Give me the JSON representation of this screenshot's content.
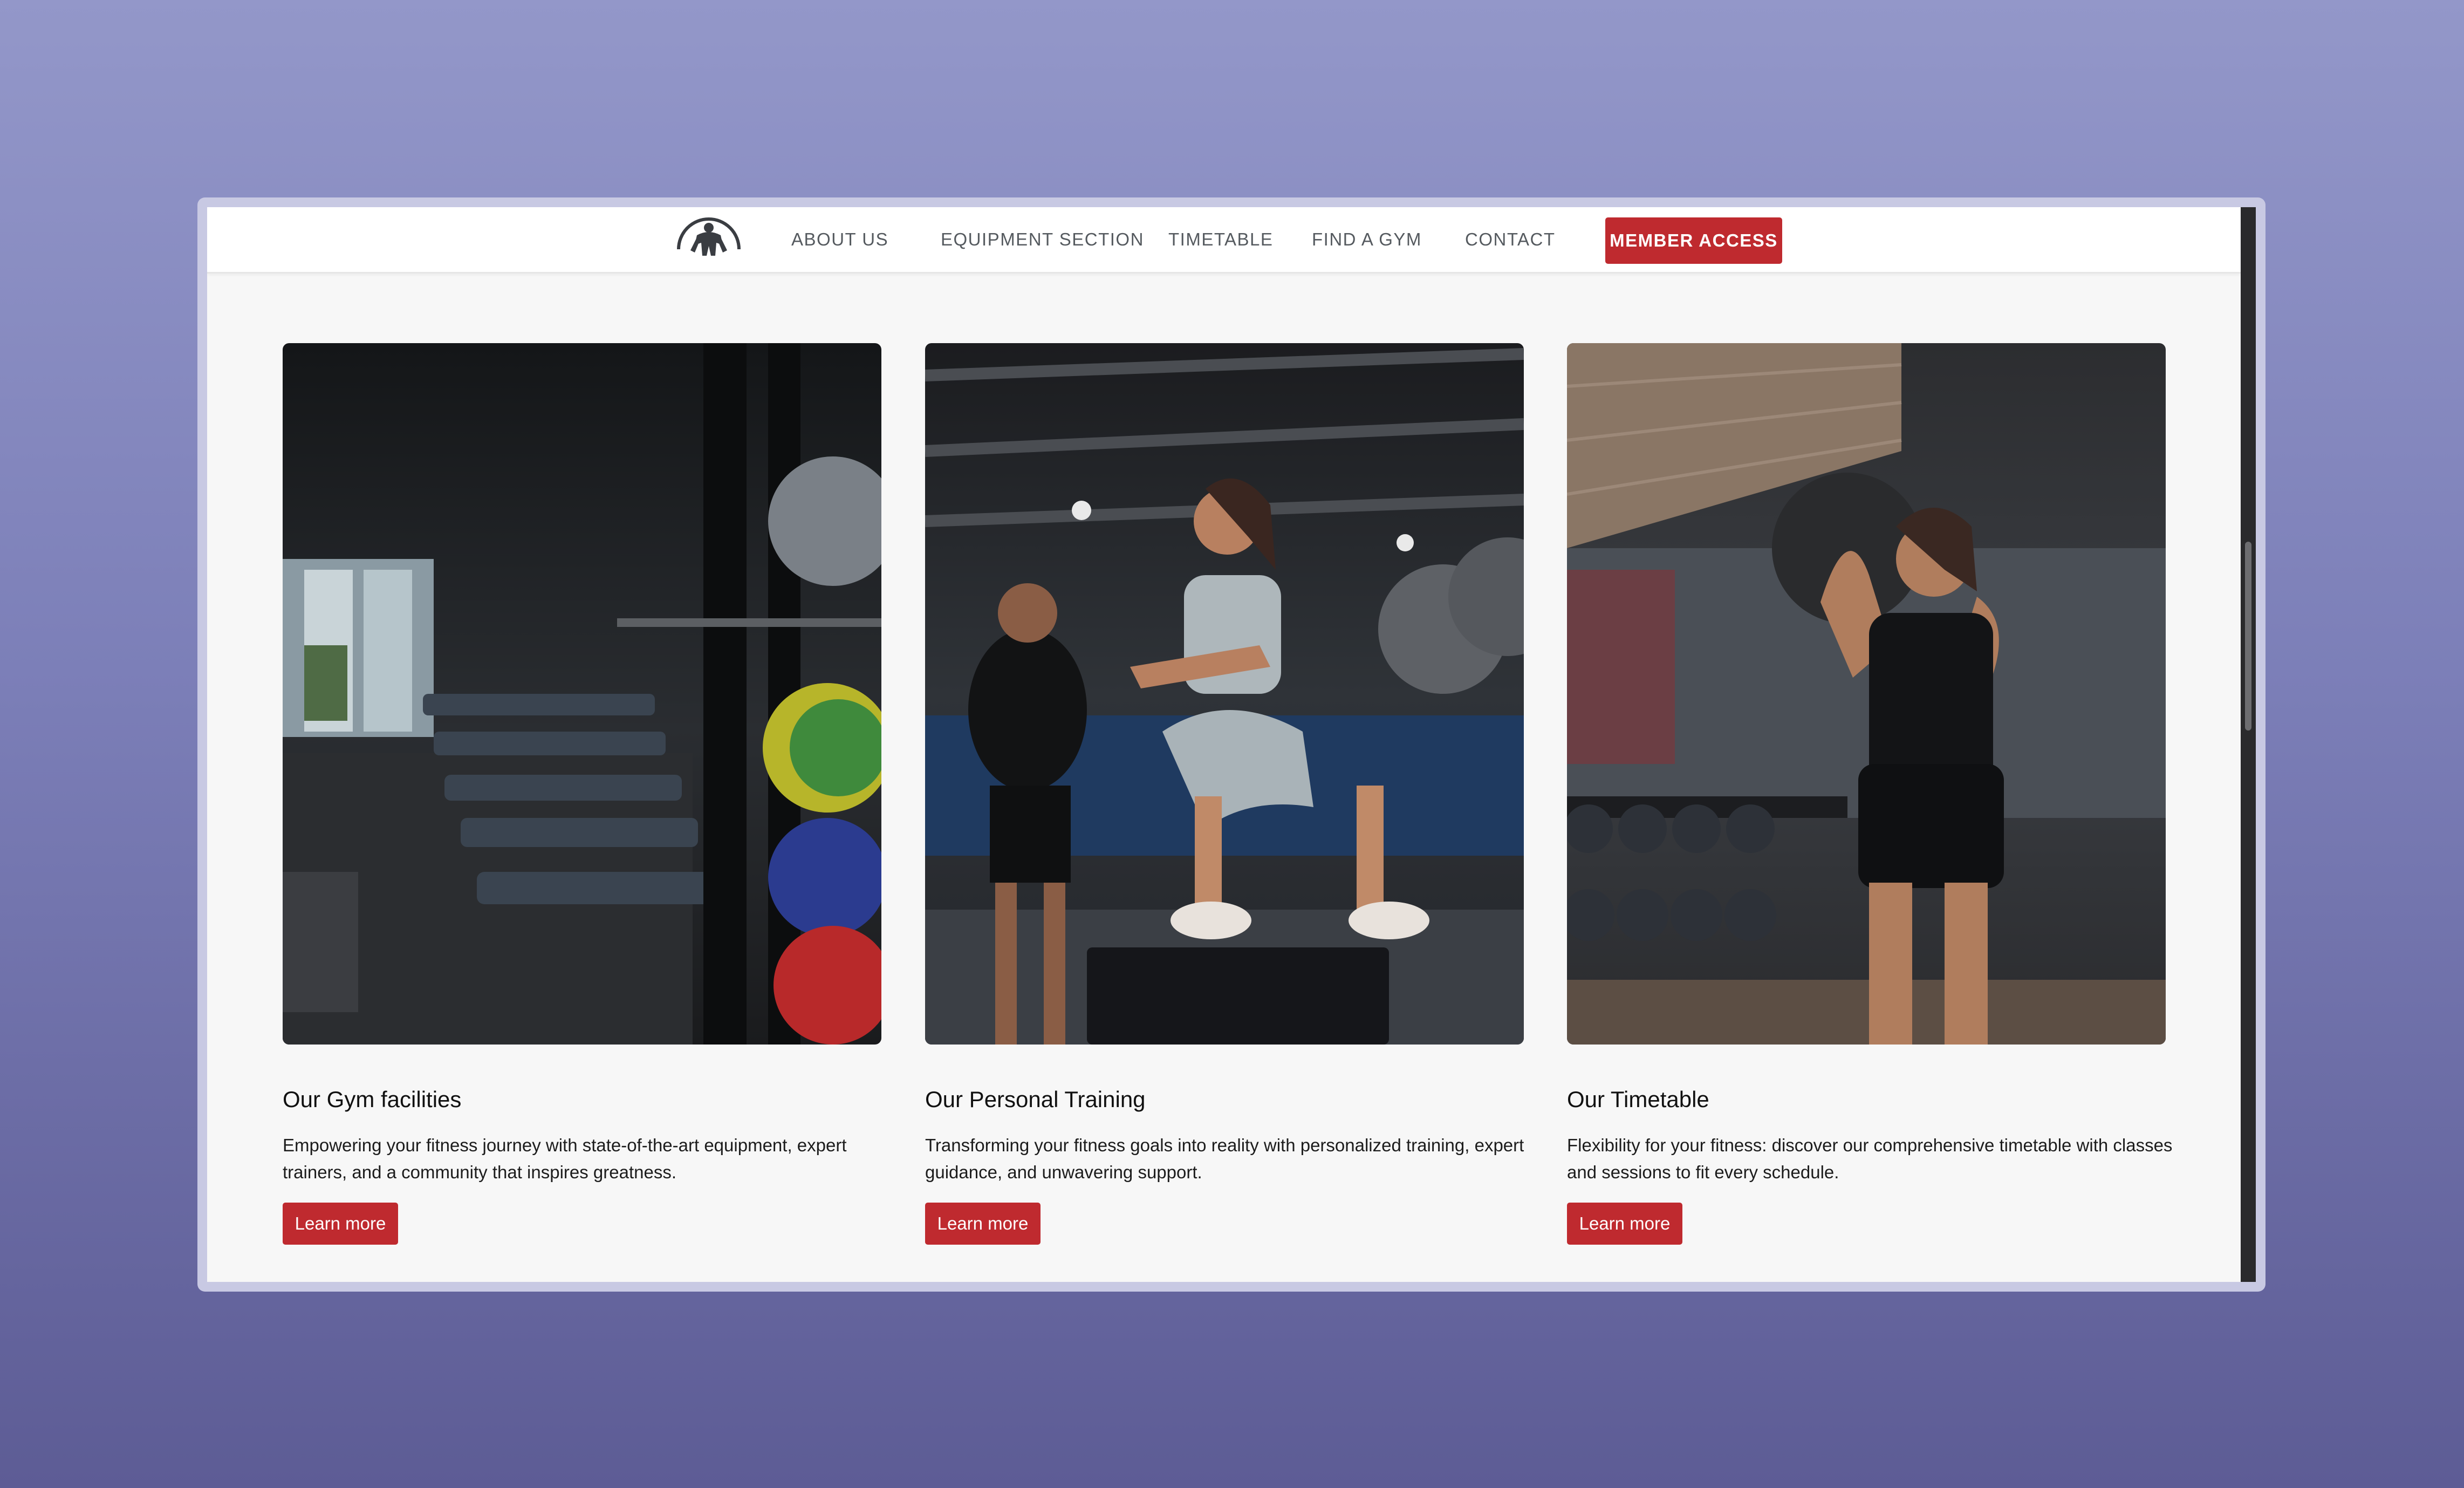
{
  "nav": {
    "logo_icon": "athlete-logo-icon",
    "links": [
      "ABOUT US",
      "EQUIPMENT SECTION",
      "TIMETABLE",
      "FIND A GYM",
      "CONTACT"
    ],
    "cta_label": "MEMBER ACCESS"
  },
  "cards": [
    {
      "image_icon": "gym-facilities-photo",
      "title": "Our Gym facilities",
      "description": "Empowering your fitness journey with state-of-the-art equipment, expert trainers, and a community that inspires greatness.",
      "button_label": "Learn more"
    },
    {
      "image_icon": "personal-training-photo",
      "title": "Our Personal Training",
      "description": "Transforming your fitness goals into reality with personalized training, expert guidance, and unwavering support.",
      "button_label": "Learn more"
    },
    {
      "image_icon": "timetable-photo",
      "title": "Our Timetable",
      "description": "Flexibility for your fitness: discover our comprehensive timetable with classes and sessions to fit every schedule.",
      "button_label": "Learn more"
    }
  ],
  "colors": {
    "accent": "#bf2a2f",
    "nav_text": "#555a5f",
    "page_background": "#f7f7f7",
    "desktop_gradient_top": "#9397c9",
    "desktop_gradient_bottom": "#5d5c95"
  }
}
